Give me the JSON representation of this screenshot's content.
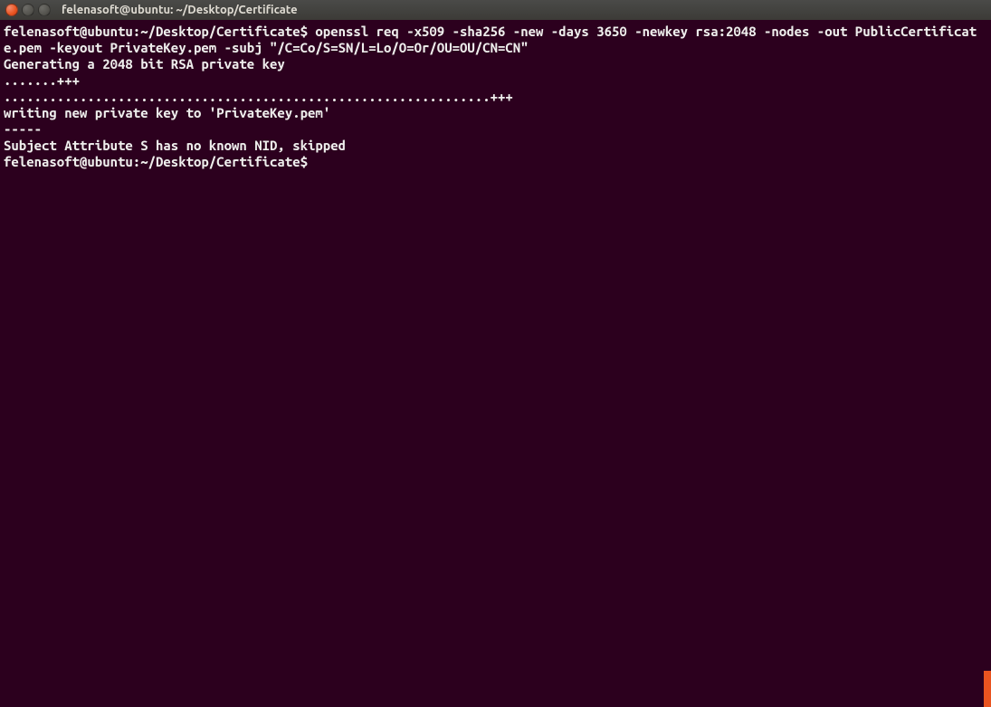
{
  "window": {
    "title": "felenasoft@ubuntu: ~/Desktop/Certificate"
  },
  "terminal": {
    "prompt1": "felenasoft@ubuntu:~/Desktop/Certificate$ ",
    "command1": "openssl req -x509 -sha256 -new -days 3650 -newkey rsa:2048 -nodes -out PublicCertificate.pem -keyout PrivateKey.pem -subj \"/C=Co/S=SN/L=Lo/O=Or/OU=OU/CN=CN\"",
    "out_line1": "Generating a 2048 bit RSA private key",
    "out_line2": ".......+++",
    "out_line3": "................................................................+++",
    "out_line4": "writing new private key to 'PrivateKey.pem'",
    "out_line5": "-----",
    "out_line6": "Subject Attribute S has no known NID, skipped",
    "prompt2": "felenasoft@ubuntu:~/Desktop/Certificate$ "
  }
}
